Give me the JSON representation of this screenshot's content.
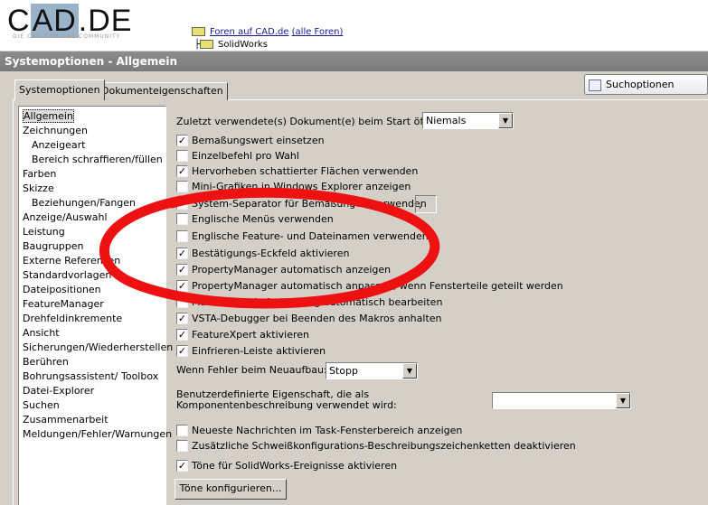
{
  "header": {
    "logo": "CAD.DE",
    "logo_tagline": "DIE CAD-CAM-CAE-COMMUNITY",
    "crumb_link": "Foren auf CAD.de",
    "crumb_all": "(alle Foren)",
    "crumb_sub": "SolidWorks"
  },
  "window": {
    "title": "Systemoptionen - Allgemein"
  },
  "tabs": [
    "Systemoptionen",
    "Dokumenteigenschaften"
  ],
  "search": {
    "label": "Suchoptionen"
  },
  "tree": [
    {
      "label": "Allgemein",
      "indent": 0,
      "selected": true
    },
    {
      "label": "Zeichnungen",
      "indent": 0
    },
    {
      "label": "Anzeigeart",
      "indent": 1
    },
    {
      "label": "Bereich schraffieren/füllen",
      "indent": 1
    },
    {
      "label": "Farben",
      "indent": 0
    },
    {
      "label": "Skizze",
      "indent": 0
    },
    {
      "label": "Beziehungen/Fangen",
      "indent": 1
    },
    {
      "label": "Anzeige/Auswahl",
      "indent": 0
    },
    {
      "label": "Leistung",
      "indent": 0
    },
    {
      "label": "Baugruppen",
      "indent": 0
    },
    {
      "label": "Externe Referenzen",
      "indent": 0
    },
    {
      "label": "Standardvorlagen",
      "indent": 0
    },
    {
      "label": "Dateipositionen",
      "indent": 0
    },
    {
      "label": "FeatureManager",
      "indent": 0
    },
    {
      "label": "Drehfeldinkremente",
      "indent": 0
    },
    {
      "label": "Ansicht",
      "indent": 0
    },
    {
      "label": "Sicherungen/Wiederherstellen",
      "indent": 0
    },
    {
      "label": "Berühren",
      "indent": 0
    },
    {
      "label": "Bohrungsassistent/ Toolbox",
      "indent": 0
    },
    {
      "label": "Datei-Explorer",
      "indent": 0
    },
    {
      "label": "Suchen",
      "indent": 0
    },
    {
      "label": "Zusammenarbeit",
      "indent": 0
    },
    {
      "label": "Meldungen/Fehler/Warnungen",
      "indent": 0
    }
  ],
  "options": {
    "recent_docs_label": "Zuletzt verwendete(s) Dokument(e) beim Start öffnen:",
    "recent_docs_value": "Niemals",
    "checks": [
      {
        "label": "Bemaßungswert einsetzen",
        "checked": true
      },
      {
        "label": "Einzelbefehl pro Wahl",
        "checked": false
      },
      {
        "label": "Hervorheben schattierter Flächen verwenden",
        "checked": true
      },
      {
        "label": "Mini-Grafiken in Windows Explorer anzeigen",
        "checked": false
      },
      {
        "label": "System-Separator für Bemaßungen verwenden",
        "checked": true
      },
      {
        "label": "Englische Menüs verwenden",
        "checked": false
      },
      {
        "label": "Englische Feature- und Dateinamen verwenden",
        "checked": false
      },
      {
        "label": "Bestätigungs-Eckfeld aktivieren",
        "checked": true
      },
      {
        "label": "PropertyManager automatisch anzeigen",
        "checked": true
      },
      {
        "label": "PropertyManager automatisch anpassen, wenn Fensterteile geteilt werden",
        "checked": true
      },
      {
        "label": "Makro nach Aufzeichnung automatisch bearbeiten",
        "checked": false
      },
      {
        "label": "VSTA-Debugger bei Beenden des Makros anhalten",
        "checked": true
      },
      {
        "label": "FeatureXpert aktivieren",
        "checked": true
      },
      {
        "label": "Einfrieren-Leiste aktivieren",
        "checked": true
      }
    ],
    "separator_value": ",",
    "rebuild_error_label": "Wenn Fehler beim Neuaufbau:",
    "rebuild_error_value": "Stopp",
    "custom_prop_label": "Benutzerdefinierte Eigenschaft, die als Komponentenbeschreibung verwendet wird:",
    "custom_prop_value": "",
    "checks2": [
      {
        "label": "Neueste Nachrichten im Task-Fensterbereich anzeigen",
        "checked": false
      },
      {
        "label": "Zusätzliche Schweißkonfigurations-Beschreibungszeichenketten deaktivieren",
        "checked": false
      },
      {
        "label": "Töne für SolidWorks-Ereignisse aktivieren",
        "checked": true
      }
    ],
    "sounds_button": "Töne konfigurieren..."
  },
  "annotation_color": "#ee1111"
}
